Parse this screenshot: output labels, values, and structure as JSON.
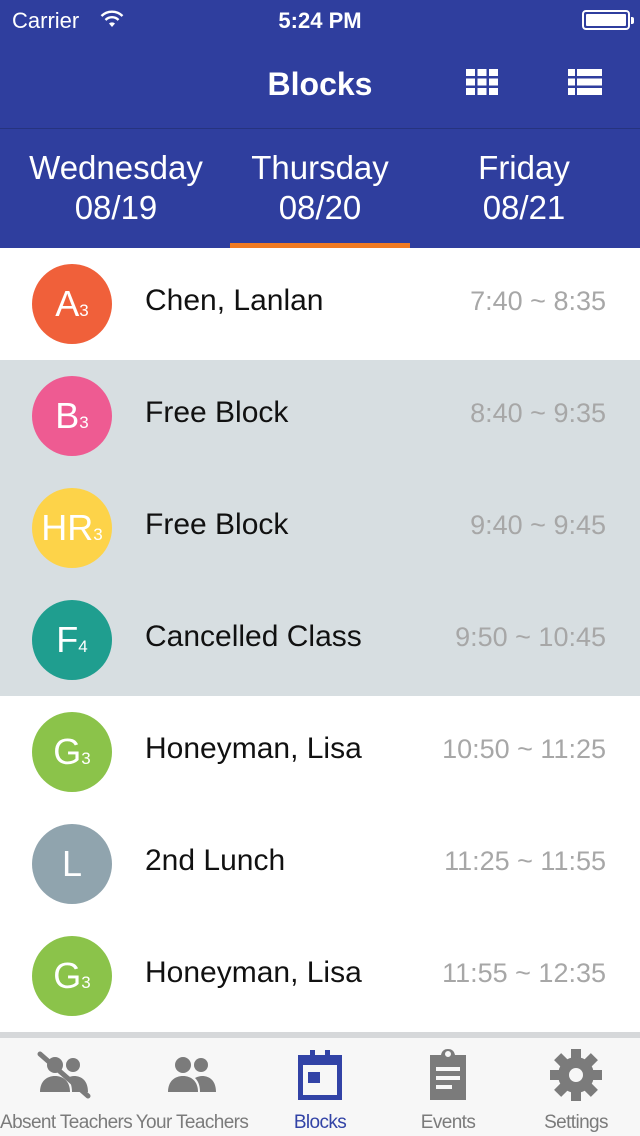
{
  "status_bar": {
    "carrier": "Carrier",
    "time": "5:24 PM"
  },
  "nav": {
    "title": "Blocks",
    "grid_icon": "grid-view-icon",
    "list_icon": "list-view-icon"
  },
  "days": [
    {
      "name": "Wednesday",
      "date": "08/19",
      "selected": false
    },
    {
      "name": "Thursday",
      "date": "08/20",
      "selected": true
    },
    {
      "name": "Friday",
      "date": "08/21",
      "selected": false
    }
  ],
  "colors": {
    "header": "#2f3e9e",
    "tab_underline": "#f07a22",
    "shaded_row": "#d7dee1",
    "active_tab": "#3243a6",
    "inactive_tab": "#7b7b7b"
  },
  "blocks": [
    {
      "letter": "A",
      "sub": "3",
      "color": "#f0603a",
      "name": "Chen, Lanlan",
      "time": "7:40 ~ 8:35",
      "shaded": false
    },
    {
      "letter": "B",
      "sub": "3",
      "color": "#ee5b92",
      "name": "Free Block",
      "time": "8:40 ~ 9:35",
      "shaded": true
    },
    {
      "letter": "HR",
      "sub": "3",
      "color": "#fdd349",
      "name": "Free Block",
      "time": "9:40 ~ 9:45",
      "shaded": true
    },
    {
      "letter": "F",
      "sub": "4",
      "color": "#1f9e8f",
      "name": "Cancelled Class",
      "time": "9:50 ~ 10:45",
      "shaded": true
    },
    {
      "letter": "G",
      "sub": "3",
      "color": "#8bc34a",
      "name": "Honeyman, Lisa",
      "time": "10:50 ~ 11:25",
      "shaded": false
    },
    {
      "letter": "L",
      "sub": "",
      "color": "#90a4ae",
      "name": "2nd Lunch",
      "time": "11:25 ~ 11:55",
      "shaded": false
    },
    {
      "letter": "G",
      "sub": "3",
      "color": "#8bc34a",
      "name": "Honeyman, Lisa",
      "time": "11:55 ~ 12:35",
      "shaded": false
    }
  ],
  "tabbar": [
    {
      "label": "Absent Teachers",
      "icon": "absent-teachers-icon",
      "active": false
    },
    {
      "label": "Your Teachers",
      "icon": "people-icon",
      "active": false
    },
    {
      "label": "Blocks",
      "icon": "calendar-icon",
      "active": true
    },
    {
      "label": "Events",
      "icon": "clipboard-icon",
      "active": false
    },
    {
      "label": "Settings",
      "icon": "gear-icon",
      "active": false
    }
  ]
}
